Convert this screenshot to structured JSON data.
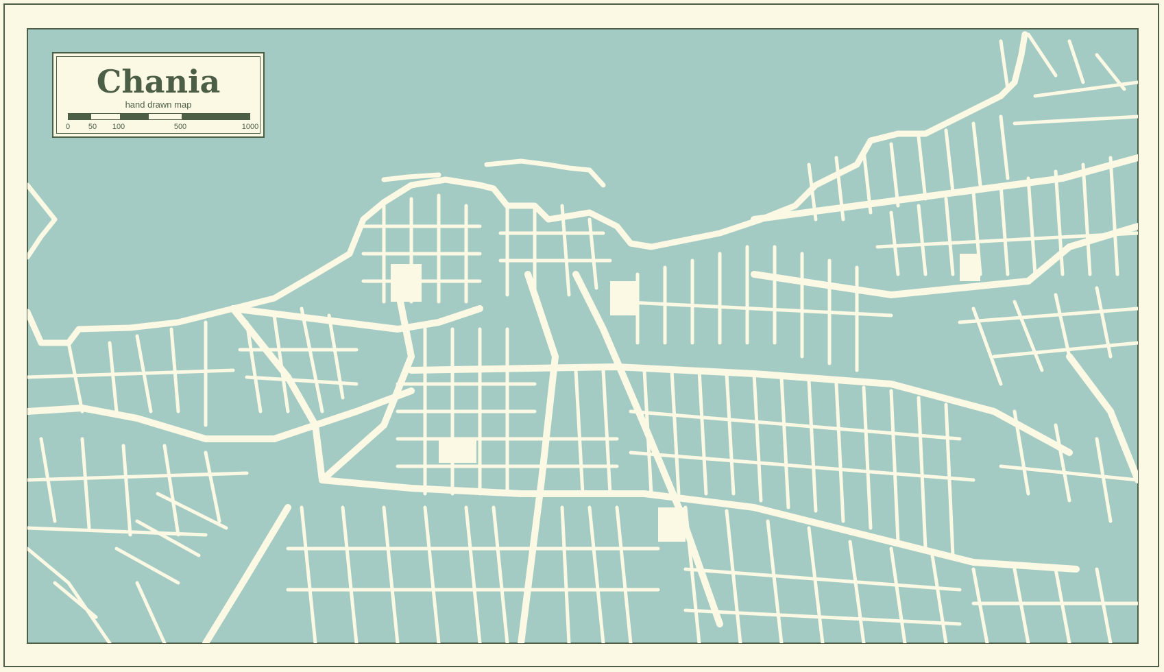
{
  "map": {
    "title": "Chania",
    "subtitle": "hand drawn map",
    "scale_labels": [
      "0",
      "50",
      "100",
      "500",
      "1000"
    ],
    "colors": {
      "water": "#a3cbc3",
      "land": "#a3cbc3",
      "roads": "#fbf8e4",
      "frame": "#4c5f46",
      "background": "#fbf8e4",
      "text": "#4c5f46"
    }
  }
}
